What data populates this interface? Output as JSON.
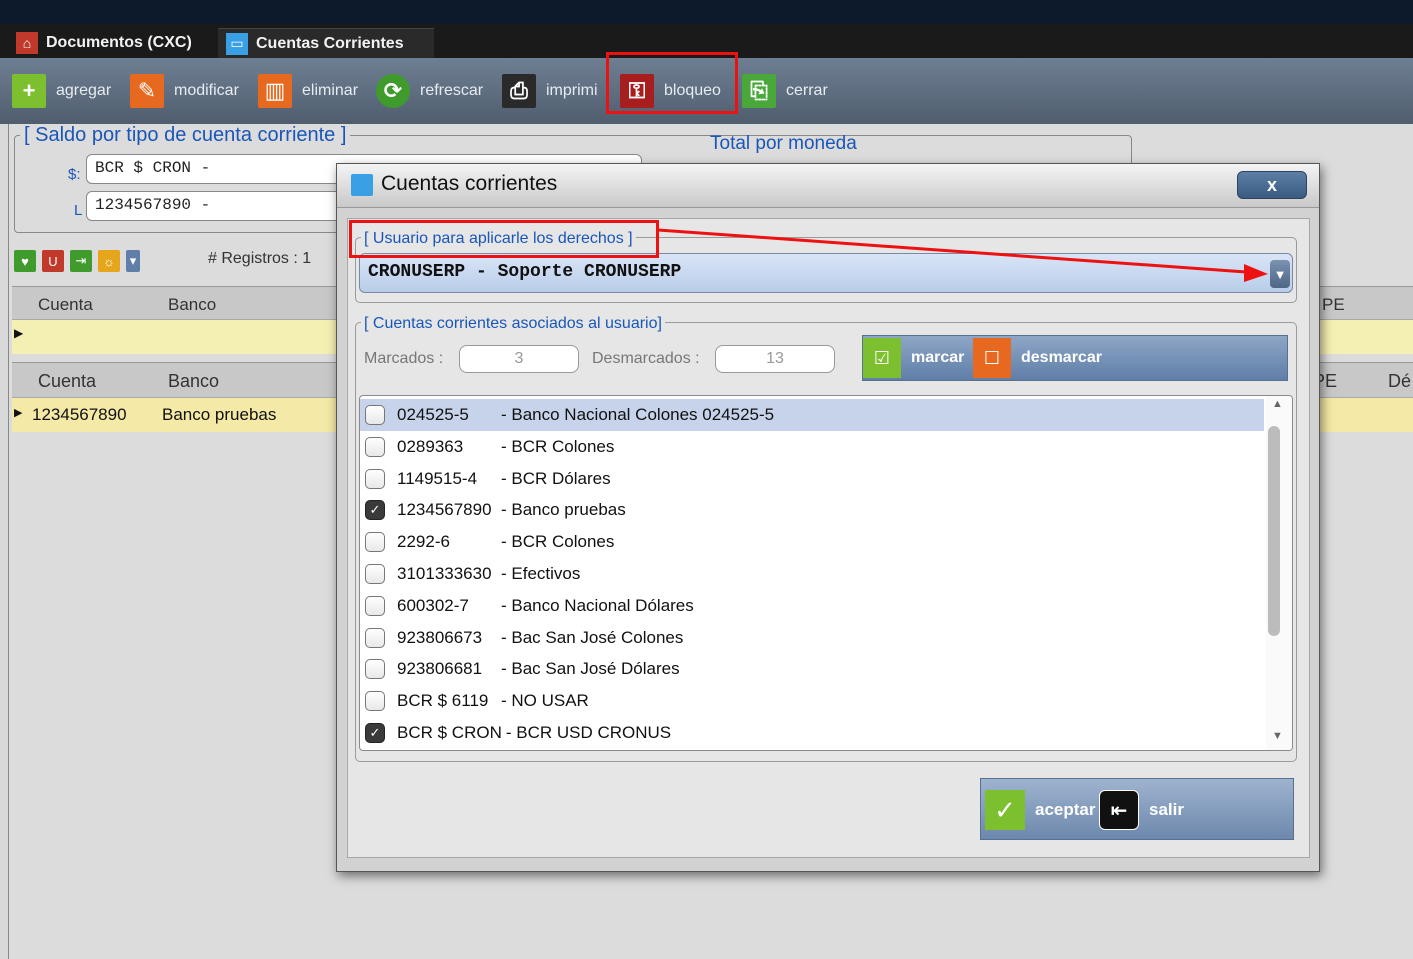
{
  "tabs": [
    {
      "label": "Documentos (CXC)",
      "icon": "documents-icon"
    },
    {
      "label": "Cuentas Corrientes",
      "icon": "accounts-icon"
    }
  ],
  "toolbar": {
    "agregar": "agregar",
    "modificar": "modificar",
    "eliminar": "eliminar",
    "refrescar": "refrescar",
    "imprimir": "imprimi",
    "bloqueo": "bloqueo",
    "cerrar": "cerrar"
  },
  "background": {
    "saldo_legend": "[ Saldo por tipo de cuenta corriente ]",
    "total_moneda": "Total por moneda",
    "label_s": "$:",
    "label_l": "L",
    "saldo_input_1": "BCR $ CRON -",
    "saldo_input_2": "1234567890 -",
    "registros": "# Registros : 1",
    "grid1": {
      "headers": [
        "Cuenta",
        "Banco"
      ],
      "right_header": "PE"
    },
    "grid2": {
      "headers": [
        "Cuenta",
        "Banco"
      ],
      "right_headers": [
        "IPE",
        "Dé"
      ]
    },
    "grid2_row": {
      "cuenta": "1234567890",
      "banco": "Banco pruebas"
    }
  },
  "dialog": {
    "title": "Cuentas corrientes",
    "close": "x",
    "usuario_legend": "[ Usuario para aplicarle los derechos ]",
    "usuario_value": "CRONUSERP - Soporte CRONUSERP",
    "cuentas_legend": "[ Cuentas corrientes asociados al usuario]",
    "marcados_label": "Marcados :",
    "marcados_value": "3",
    "desmarcados_label": "Desmarcados :",
    "desmarcados_value": "13",
    "marcar": "marcar",
    "desmarcar": "desmarcar",
    "items": [
      {
        "account": "024525-5",
        "name": "- Banco Nacional Colones  024525-5",
        "checked": false,
        "selected": true
      },
      {
        "account": "0289363",
        "name": "- BCR Colones",
        "checked": false
      },
      {
        "account": "1149515-4",
        "name": "- BCR Dólares",
        "checked": false
      },
      {
        "account": "1234567890",
        "name": "- Banco pruebas",
        "checked": true
      },
      {
        "account": "2292-6",
        "name": "- BCR Colones",
        "checked": false
      },
      {
        "account": "3101333630",
        "name": "- Efectivos",
        "checked": false
      },
      {
        "account": "600302-7",
        "name": "- Banco Nacional Dólares",
        "checked": false
      },
      {
        "account": "923806673",
        "name": "- Bac San José Colones",
        "checked": false
      },
      {
        "account": "923806681",
        "name": "- Bac San José Dólares",
        "checked": false
      },
      {
        "account": "BCR $ 6119",
        "name": "- NO USAR",
        "checked": false
      },
      {
        "account": "BCR $ CRON",
        "name": "- BCR USD CRONUS",
        "checked": true
      }
    ],
    "aceptar": "aceptar",
    "salir": "salir"
  },
  "colors": {
    "annotation": "#ee1111",
    "legend": "#1a56b8",
    "list_selected": "#c6d3eb"
  }
}
